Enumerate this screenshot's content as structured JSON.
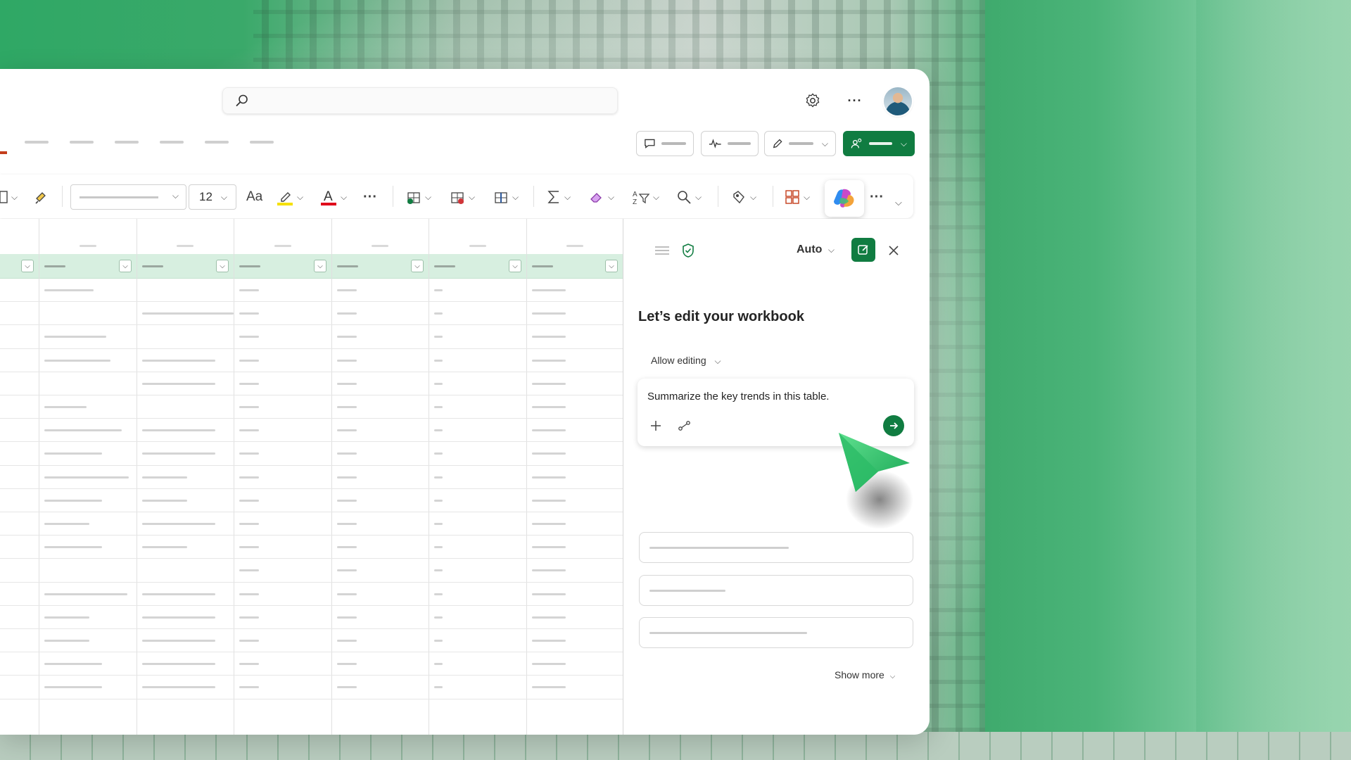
{
  "window": {
    "title": ""
  },
  "ribbon": {
    "font_size": "12",
    "aa_label": "Aa"
  },
  "copilot_pane": {
    "mode": "Auto",
    "title": "Let’s edit your workbook",
    "allow_editing": "Allow editing",
    "prompt": "Summarize the key trends in this table.",
    "show_more": "Show more"
  },
  "colors": {
    "excel_green": "#107c41",
    "header_band": "#d7efe0",
    "active_tab": "#c43e1c"
  }
}
